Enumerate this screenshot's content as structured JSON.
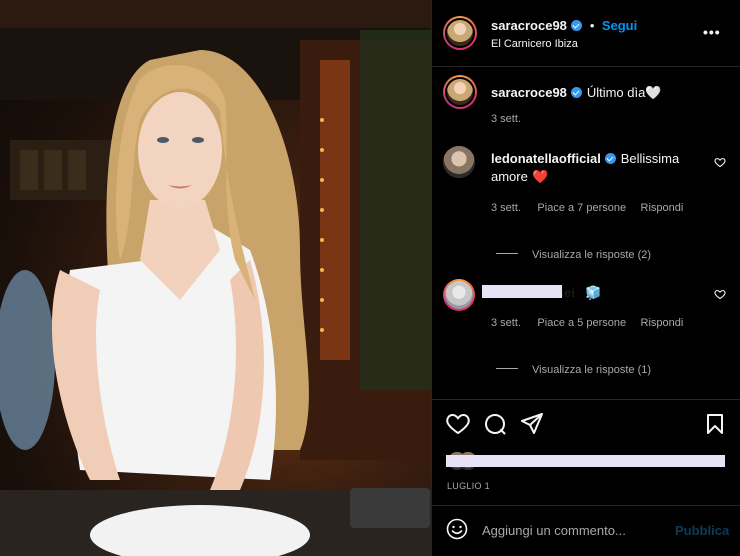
{
  "post": {
    "author": "saracroce98",
    "follow_label": "Segui",
    "location": "El Carnicero Ibiza",
    "more_label": "•••",
    "caption_text": "Último dìa",
    "caption_emoji": "🤍",
    "caption_time": "3 sett."
  },
  "comments": [
    {
      "user": "ledonatellaofficial",
      "text_line1": "Bellissima",
      "text_line2": "amore",
      "emoji": "❤️",
      "time": "3 sett.",
      "likes": "Piace a 7 persone",
      "reply_label": "Rispondi",
      "view_replies": "Visualizza le risposte (2)"
    },
    {
      "user": "camilla.seisei",
      "emoji": "🧊",
      "time": "3 sett.",
      "likes": "Piace a 5 persone",
      "reply_label": "Rispondi",
      "view_replies": "Visualizza le risposte (1)"
    }
  ],
  "footer": {
    "date": "LUGLIO 1",
    "comment_placeholder": "Aggiungi un commento...",
    "publish_label": "Pubblica"
  }
}
